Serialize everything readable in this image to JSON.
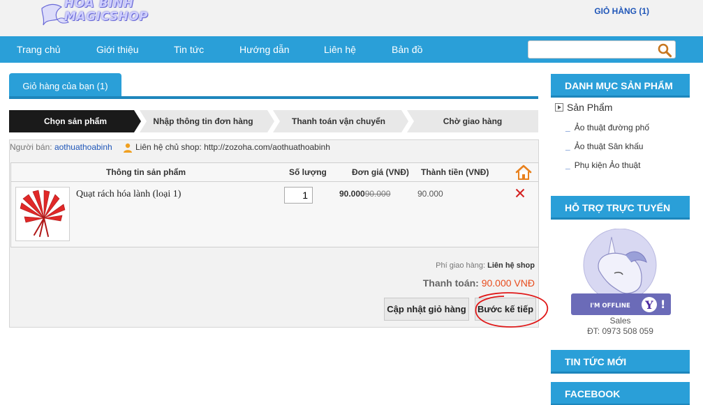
{
  "header": {
    "logo_line1": "HÒA BÌNH",
    "logo_line2": "MAGICSHOP",
    "cart_link": "GIỎ HÀNG (1)"
  },
  "nav": {
    "items": [
      "Trang chủ",
      "Giới thiệu",
      "Tin tức",
      "Hướng dẫn",
      "Liên hệ",
      "Bản đồ"
    ],
    "search_value": "",
    "search_icon": "search-icon"
  },
  "main": {
    "tab_label": "Giỏ hàng của bạn (1)",
    "steps": [
      "Chọn sản phẩm",
      "Nhập thông tin đơn hàng",
      "Thanh toán vận chuyển",
      "Chờ giao hàng"
    ],
    "active_step_color": "#1a1a1a",
    "seller_label": "Người bán:",
    "seller_name": "aothuathoabinh",
    "contact_text": "Liên hệ chủ shop: http://zozoha.com/aothuathoabinh",
    "table": {
      "headers": [
        "Thông tin sản phẩm",
        "Số lượng",
        "Đơn giá (VNĐ)",
        "Thành tiền (VNĐ)"
      ],
      "rows": [
        {
          "name": "Quạt rách hóa lành (loại 1)",
          "quantity": "1",
          "price_new": "90.000",
          "price_old": "90.000",
          "total": "90.000"
        }
      ]
    },
    "shipping_label": "Phí giao hàng:",
    "shipping_value": "Liên hệ shop",
    "pay_label": "Thanh toán:",
    "pay_amount": "90.000 VNĐ",
    "update_button": "Cập nhật giỏ hàng",
    "next_button": "Bước kế tiếp"
  },
  "sidebar": {
    "categories_title": "DANH MỤC SẢN PHẨM",
    "root_category": "Sản Phẩm",
    "sub_categories": [
      "Ảo thuật đường phố",
      "Ảo thuật Sân khấu",
      "Phụ kiện Ảo thuật"
    ],
    "support_title": "HỖ TRỢ TRỰC TUYẾN",
    "status_badge": "I'M OFFLINE",
    "sales_label": "Sales",
    "sales_phone": "ĐT: 0973 508 059",
    "news_title": "TIN TỨC MỚI",
    "facebook_title": "FACEBOOK"
  },
  "colors": {
    "accent": "#2a9fd8",
    "accent_dark": "#1d86bc",
    "link": "#1f56b8",
    "price_highlight": "#e84c1d",
    "delete": "#d42020"
  }
}
